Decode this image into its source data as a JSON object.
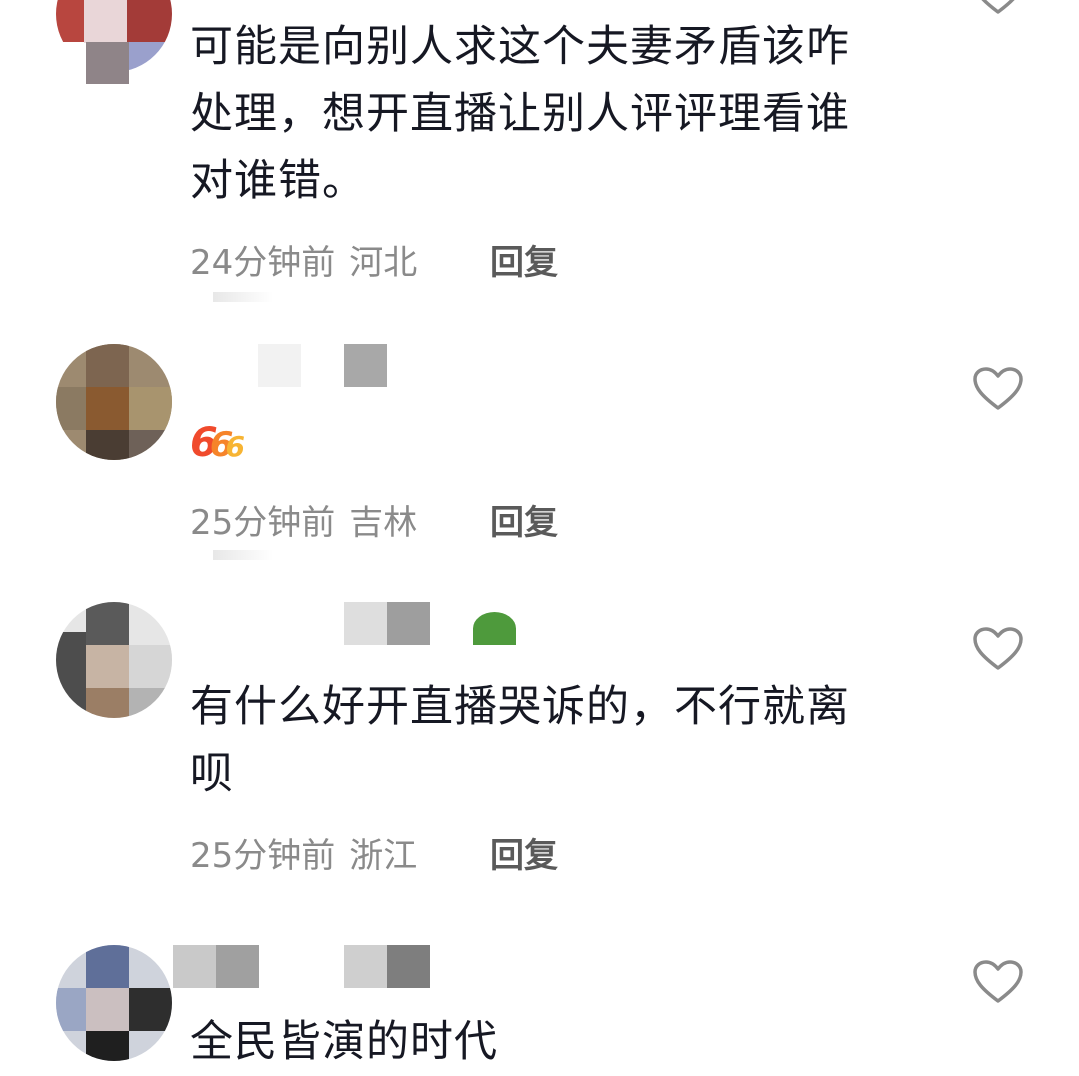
{
  "accent_colors": {
    "text": "#161823",
    "meta": "#8a8a8a",
    "reply": "#5a5a5a",
    "like_icon": "#8a8a8a"
  },
  "comments": [
    {
      "content": "可能是向别人求这个夫妻矛盾该咋\n处理，想开直播让别人评评理看谁\n对谁错。",
      "time": "24分钟前",
      "location": "河北",
      "reply_label": "回复",
      "like_icon": "heart-outline-icon"
    },
    {
      "emoji": "666",
      "time": "25分钟前",
      "location": "吉林",
      "reply_label": "回复",
      "like_icon": "heart-outline-icon"
    },
    {
      "content": "有什么好开直播哭诉的，不行就离\n呗",
      "time": "25分钟前",
      "location": "浙江",
      "reply_label": "回复",
      "like_icon": "heart-outline-icon"
    },
    {
      "content": "全民皆演的时代",
      "like_icon": "heart-outline-icon"
    }
  ]
}
